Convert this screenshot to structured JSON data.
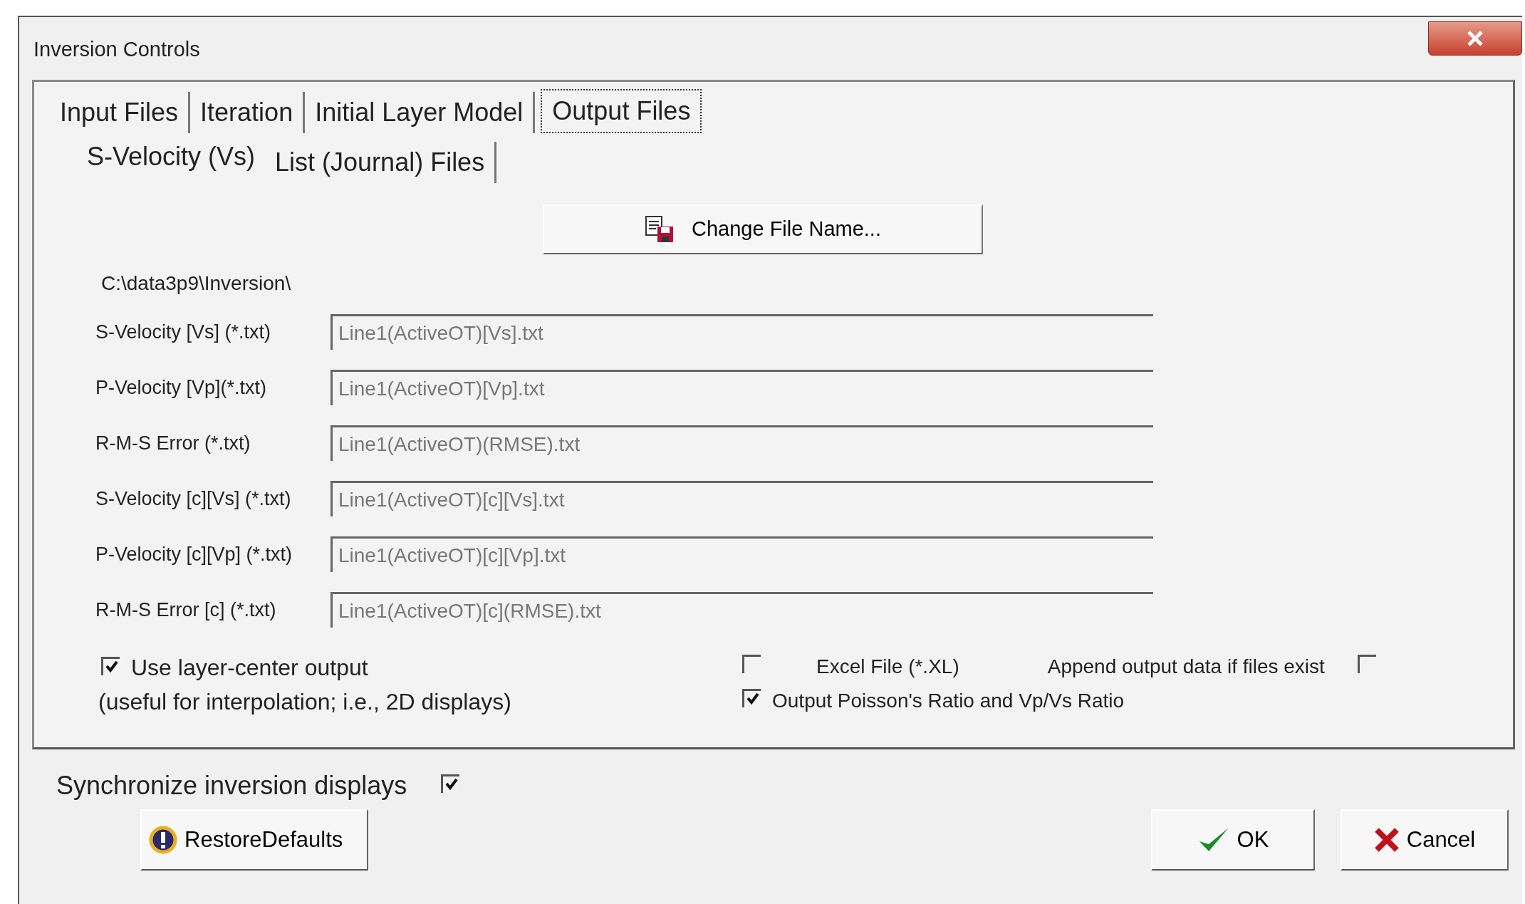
{
  "window": {
    "title": "Inversion Controls"
  },
  "tabs": [
    {
      "label": "Input Files",
      "selected": false
    },
    {
      "label": "Iteration",
      "selected": false
    },
    {
      "label": "Initial Layer Model",
      "selected": false
    },
    {
      "label": "Output Files",
      "selected": true
    }
  ],
  "subtabs": [
    {
      "label": "S-Velocity (Vs)",
      "selected": true
    },
    {
      "label": "List (Journal) Files",
      "selected": false
    }
  ],
  "change_file_button": {
    "label": "Change File Name..."
  },
  "folder_path": "C:\\data3p9\\Inversion\\",
  "files": [
    {
      "label": "S-Velocity [Vs] (*.txt)",
      "value": "Line1(ActiveOT)[Vs].txt",
      "disabled": true
    },
    {
      "label": "P-Velocity [Vp](*.txt)",
      "value": "Line1(ActiveOT)[Vp].txt",
      "disabled": true
    },
    {
      "label": "R-M-S Error (*.txt)",
      "value": "Line1(ActiveOT)(RMSE).txt",
      "disabled": true
    },
    {
      "label": "S-Velocity [c][Vs] (*.txt)",
      "value": "Line1(ActiveOT)[c][Vs].txt",
      "disabled": true
    },
    {
      "label": "P-Velocity [c][Vp] (*.txt)",
      "value": "Line1(ActiveOT)[c][Vp].txt",
      "disabled": true
    },
    {
      "label": "R-M-S Error [c] (*.txt)",
      "value": "Line1(ActiveOT)[c](RMSE).txt",
      "disabled": true
    }
  ],
  "layer_center": {
    "label": "Use layer-center output",
    "note": "(useful for interpolation; i.e., 2D displays)",
    "checked": true
  },
  "excel_file": {
    "label": "Excel File (*.XL)",
    "checked": false
  },
  "append_output": {
    "label": "Append output data if files exist",
    "checked": false
  },
  "poisson_ratio": {
    "label": "Output Poisson's Ratio and Vp/Vs Ratio",
    "checked": true
  },
  "synchronize": {
    "label": "Synchronize inversion displays",
    "checked": true
  },
  "buttons": [
    {
      "kind": "restore",
      "label": "RestoreDefaults"
    },
    {
      "kind": "ok",
      "label": "OK"
    },
    {
      "kind": "cancel",
      "label": "Cancel"
    }
  ]
}
